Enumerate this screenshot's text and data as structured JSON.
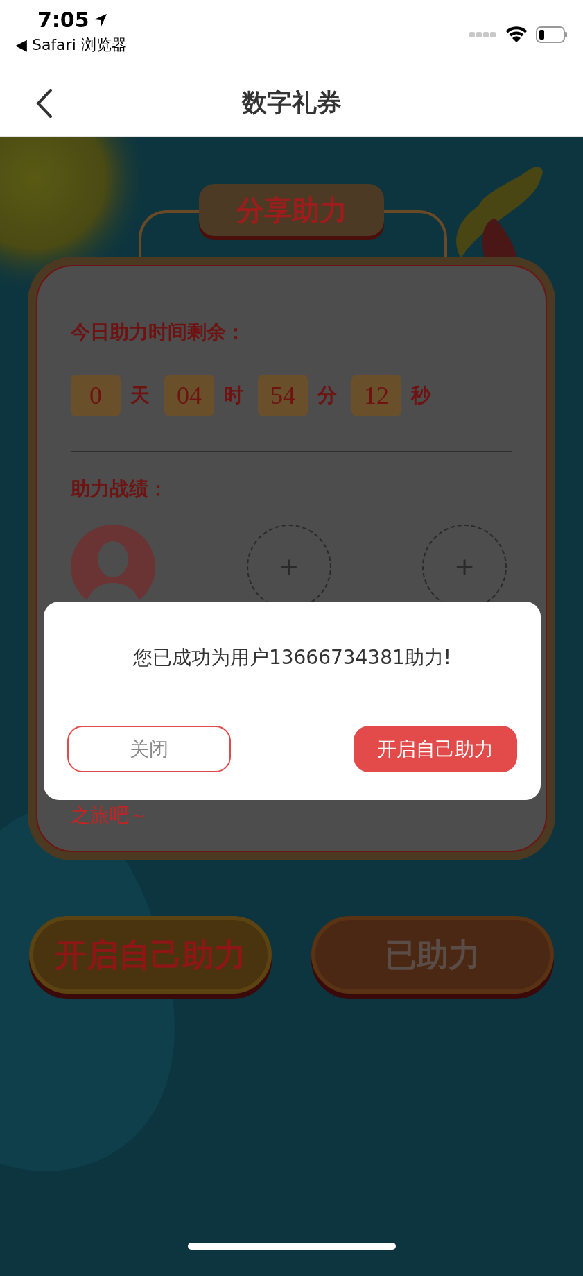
{
  "status_bar": {
    "time": "7:05",
    "back_app": "◀ Safari 浏览器"
  },
  "nav": {
    "title": "数字礼券"
  },
  "panel": {
    "title": "分享助力",
    "countdown_label": "今日助力时间剩余：",
    "countdown": [
      {
        "value": "0",
        "unit": "天"
      },
      {
        "value": "04",
        "unit": "时"
      },
      {
        "value": "54",
        "unit": "分"
      },
      {
        "value": "12",
        "unit": "秒"
      }
    ],
    "record_label": "助力战绩：",
    "helpers": [
      {
        "kind": "avatar"
      },
      {
        "kind": "empty",
        "symbol": "+"
      },
      {
        "kind": "empty",
        "symbol": "+"
      }
    ],
    "note": "之旅吧～"
  },
  "dialog": {
    "message": "您已成功为用户13666734381助力!",
    "buttons": [
      {
        "label": "关闭",
        "kind": "outline"
      },
      {
        "label": "开启自己助力",
        "kind": "primary"
      }
    ]
  },
  "actions": [
    {
      "label": "开启自己助力",
      "kind": "active"
    },
    {
      "label": "已助力",
      "kind": "done"
    }
  ]
}
